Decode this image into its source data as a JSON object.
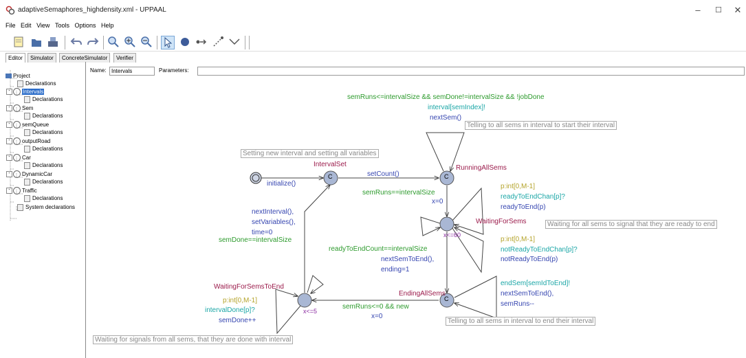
{
  "window": {
    "title": "adaptiveSemaphores_highdensity.xml - UPPAAL",
    "minimize": "–",
    "maximize": "☐",
    "close": "✕"
  },
  "menu": [
    "File",
    "Edit",
    "View",
    "Tools",
    "Options",
    "Help"
  ],
  "tabs": [
    "Editor",
    "Simulator",
    "ConcreteSimulator",
    "Verifier"
  ],
  "tree": {
    "project": "Project",
    "items": [
      "Declarations",
      "Intervals",
      "Declarations",
      "Sem",
      "Declarations",
      "semQueue",
      "Declarations",
      "outputRoad",
      "Declarations",
      "Car",
      "Declarations",
      "DynamicCar",
      "Declarations",
      "Traffic",
      "Declarations",
      "System declarations"
    ]
  },
  "editor": {
    "name_label": "Name:",
    "name_value": "Intervals",
    "params_label": "Parameters:",
    "params_value": ""
  },
  "diagram": {
    "loc_intervalset": "IntervalSet",
    "loc_running": "RunningAllSems",
    "loc_waiting": "WaitingForSems",
    "loc_ending": "EndingAllSems",
    "loc_waiting_end": "WaitingForSemsToEnd",
    "committed": "C",
    "inv_waiting": "x<=60",
    "inv_waiting_end": "x<=5",
    "init_update": "initialize()",
    "e_setcount": "setCount()",
    "e_loop_guard": "semRuns<=intervalSize && semDone!=intervalSize && !jobDone",
    "e_loop_sync": "interval[semIndex]!",
    "e_loop_update": "nextSem()",
    "e_r2w_guard": "semRuns==intervalSize",
    "e_r2w_update": "x=0",
    "e_wself1_select": "p:int[0,M-1]",
    "e_wself1_sync": "readyToEndChan[p]?",
    "e_wself1_update": "readyToEnd(p)",
    "e_wself2_select": "p:int[0,M-1]",
    "e_wself2_sync": "notReadyToEndChan[p]?",
    "e_wself2_update": "notReadyToEnd(p)",
    "e_w2e_guard": "readyToEndCount==intervalSize",
    "e_w2e_update1": "nextSemToEnd(),",
    "e_w2e_update2": "ending=1",
    "e_eself_sync": "endSem[semIdToEnd]!",
    "e_eself_update1": "nextSemToEnd(),",
    "e_eself_update2": "semRuns--",
    "e_e2we_guard": "semRuns<=0 && new",
    "e_e2we_update": "x=0",
    "e_weself_select": "p:int[0,M-1]",
    "e_weself_sync": "intervalDone[p]?",
    "e_weself_update": "semDone++",
    "e_we2is_update1": "nextInterval(),",
    "e_we2is_update2": "setVariables(),",
    "e_we2is_update3": "time=0",
    "e_we2is_guard": "semDone==intervalSize",
    "c1": "Setting new interval and setting all variables",
    "c2": "Telling to all sems in interval to start their interval",
    "c3": "Waiting for all sems to signal that they are ready to end",
    "c4": "Telling to all sems in interval to end their interval",
    "c5": "Waiting for signals from all sems, that they are done with interval"
  }
}
